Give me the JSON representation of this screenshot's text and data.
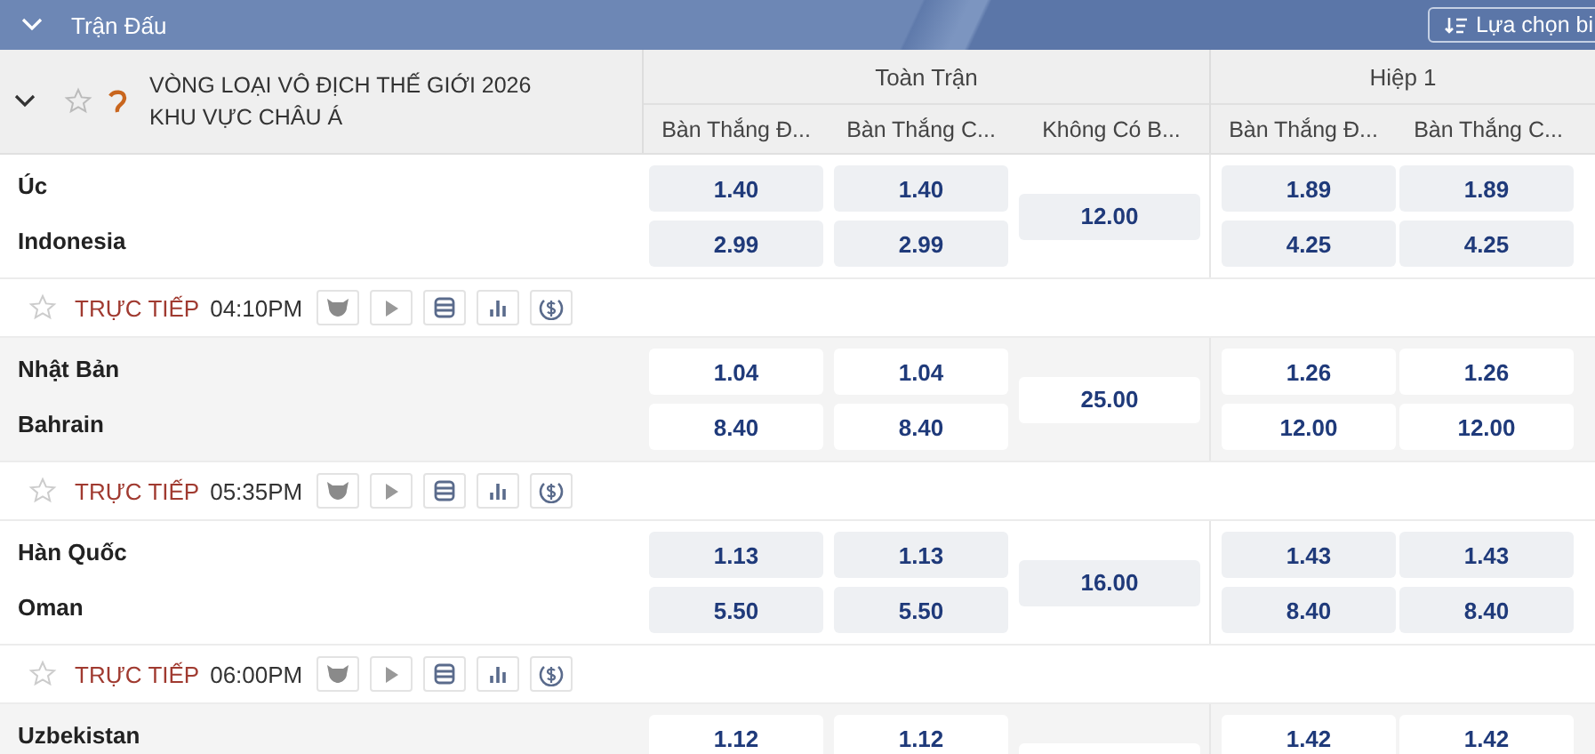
{
  "top_bar": {
    "title": "Trận Đấu",
    "filter_button": "Lựa chọn bi"
  },
  "league": {
    "name": "VÒNG LOẠI VÔ ĐỊCH THẾ GIỚI 2026 KHU VỰC CHÂU Á",
    "groups": [
      {
        "label": "Toàn Trận",
        "columns": [
          "Bàn Thắng Đ...",
          "Bàn Thắng C...",
          "Không Có B..."
        ]
      },
      {
        "label": "Hiệp 1",
        "columns": [
          "Bàn Thắng Đ...",
          "Bàn Thắng C..."
        ]
      }
    ]
  },
  "matches": [
    {
      "rows": [
        {
          "team": "Úc",
          "odds": [
            "1.40",
            "1.40",
            "1.89",
            "1.89"
          ]
        },
        {
          "team": "Indonesia",
          "odds": [
            "2.99",
            "2.99",
            "4.25",
            "4.25"
          ]
        }
      ],
      "draw": "12.00",
      "live": {
        "label": "TRỰC TIẾP",
        "time": "04:10PM"
      }
    },
    {
      "rows": [
        {
          "team": "Nhật Bản",
          "odds": [
            "1.04",
            "1.04",
            "1.26",
            "1.26"
          ]
        },
        {
          "team": "Bahrain",
          "odds": [
            "8.40",
            "8.40",
            "12.00",
            "12.00"
          ]
        }
      ],
      "draw": "25.00",
      "live": {
        "label": "TRỰC TIẾP",
        "time": "05:35PM"
      }
    },
    {
      "rows": [
        {
          "team": "Hàn Quốc",
          "odds": [
            "1.13",
            "1.13",
            "1.43",
            "1.43"
          ]
        },
        {
          "team": "Oman",
          "odds": [
            "5.50",
            "5.50",
            "8.40",
            "8.40"
          ]
        }
      ],
      "draw": "16.00",
      "live": {
        "label": "TRỰC TIẾP",
        "time": "06:00PM"
      }
    },
    {
      "rows": [
        {
          "team": "Uzbekistan",
          "odds": [
            "1.12",
            "1.12",
            "1.42",
            "1.42"
          ]
        }
      ]
    }
  ]
}
